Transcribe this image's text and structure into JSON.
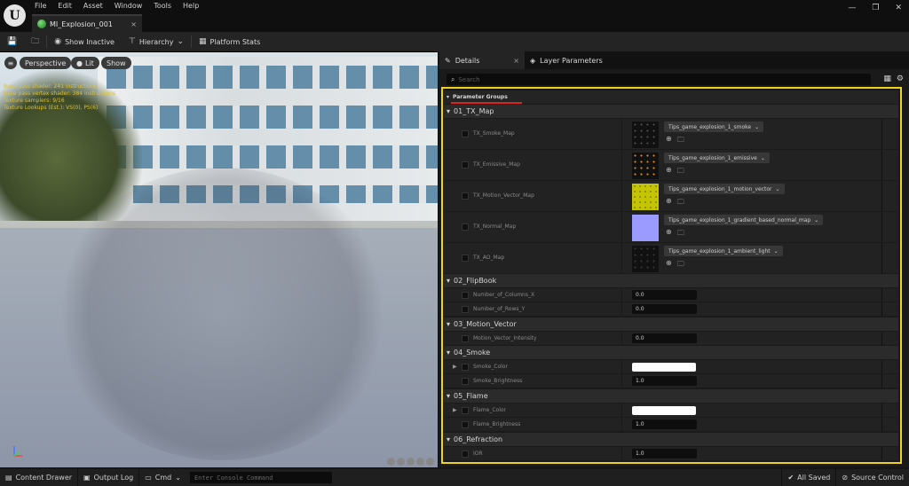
{
  "app": {
    "logo_glyph": "U"
  },
  "menu": [
    "File",
    "Edit",
    "Asset",
    "Window",
    "Tools",
    "Help"
  ],
  "doc_tab": {
    "label": "MI_Explosion_001",
    "close": "×"
  },
  "window_controls": [
    "—",
    "❐",
    "✕"
  ],
  "toolbar": {
    "show_inactive": "Show Inactive",
    "hierarchy": "Hierarchy",
    "platform_stats": "Platform Stats"
  },
  "viewport": {
    "perspective": "Perspective",
    "lit": "Lit",
    "show": "Show",
    "stats": [
      "Base pass shader: 241 instructions",
      "Base pass vertex shader: 384 instructions",
      "Texture samplers: 9/16",
      "Texture Lookups (Est.): VS(0), PS(6)"
    ]
  },
  "details": {
    "tab_details": "Details",
    "tab_layer": "Layer Parameters",
    "search_placeholder": "Search",
    "parameter_groups": "Parameter Groups",
    "groups": [
      {
        "title": "01_TX_Map"
      },
      {
        "title": "02_FlipBook"
      },
      {
        "title": "03_Motion_Vector"
      },
      {
        "title": "04_Smoke"
      },
      {
        "title": "05_Flame"
      },
      {
        "title": "06_Refraction"
      }
    ],
    "textures": [
      {
        "name": "TX_Smoke_Map",
        "asset": "Tips_game_explosion_1_smoke"
      },
      {
        "name": "TX_Emissive_Map",
        "asset": "Tips_game_explosion_1_emissive"
      },
      {
        "name": "TX_Motion_Vector_Map",
        "asset": "Tips_game_explosion_1_motion_vector"
      },
      {
        "name": "TX_Normal_Map",
        "asset": "Tips_game_explosion_1_gradient_based_normal_map"
      },
      {
        "name": "TX_AO_Map",
        "asset": "Tips_game_explosion_1_ambient_light"
      }
    ],
    "flipbook": [
      {
        "name": "Number_of_Columns_X",
        "value": "0.0"
      },
      {
        "name": "Number_of_Rows_Y",
        "value": "0.0"
      }
    ],
    "motion": [
      {
        "name": "Motion_Vector_Intensity",
        "value": "0.0"
      }
    ],
    "smoke": {
      "color_name": "Smoke_Color",
      "brightness_name": "Smoke_Brightness",
      "brightness": "1.0"
    },
    "flame": {
      "color_name": "Flame_Color",
      "brightness_name": "Flame_Brightness",
      "brightness": "1.0"
    },
    "refraction": [
      {
        "name": "IOR",
        "value": "1.0"
      }
    ]
  },
  "statusbar": {
    "content_drawer": "Content Drawer",
    "output_log": "Output Log",
    "cmd": "Cmd",
    "console_placeholder": "Enter Console Command",
    "all_saved": "All Saved",
    "source_control": "Source Control"
  },
  "colors": {
    "highlight_frame": "#f2d21a",
    "underline": "#e02020"
  }
}
